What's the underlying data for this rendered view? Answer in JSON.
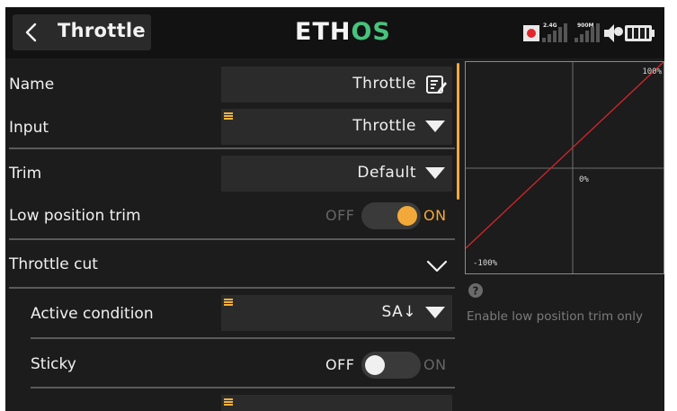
{
  "header": {
    "title": "Throttle",
    "logo_main": "ETH",
    "logo_accent": "OS",
    "rf_label_1": "2.4G",
    "rf_label_2": "900M"
  },
  "rows": {
    "name": {
      "label": "Name",
      "value": "Throttle"
    },
    "input": {
      "label": "Input",
      "value": "Throttle"
    },
    "trim": {
      "label": "Trim",
      "value": "Default"
    },
    "low_position_trim": {
      "label": "Low position trim",
      "off": "OFF",
      "on": "ON",
      "state": "on"
    },
    "throttle_cut": {
      "label": "Throttle cut"
    },
    "active_condition": {
      "label": "Active condition",
      "value": "SA↓"
    },
    "sticky": {
      "label": "Sticky",
      "off": "OFF",
      "on": "ON",
      "state": "off"
    }
  },
  "curve": {
    "top_right": "100%",
    "center": "0%",
    "bottom_left": "-100%",
    "line_color": "#d7262c"
  },
  "help": {
    "text": "Enable low position trim only"
  },
  "colors": {
    "accent": "#f3a93a",
    "logo_green": "#47c37c"
  }
}
